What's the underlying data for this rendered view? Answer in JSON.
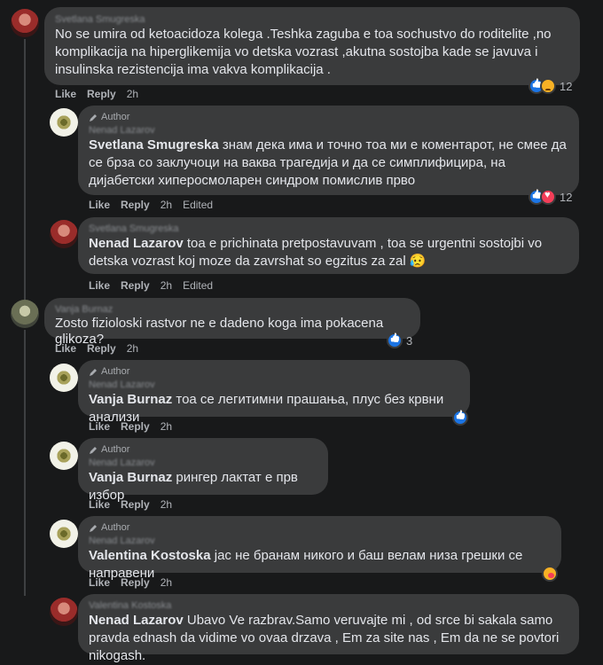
{
  "labels": {
    "like": "Like",
    "reply": "Reply",
    "author": "Author",
    "edited": "Edited"
  },
  "comments": [
    {
      "header_name": "Svetlana Smugreska",
      "text": "No se umira od ketoacidoza kolega .Teshka zaguba e toa sochustvo do roditelite ,no komplikacija na hiperglikemija vo detska vozrast ,akutna sostojba kade se javuva i insulinska rezistencija ima vakva komplikacija .",
      "time": "2h",
      "reaction_icons": [
        "like-icon",
        "sad-icon"
      ],
      "reaction_count": "12"
    },
    {
      "is_author": true,
      "header_name": "Nenad Lazarov",
      "mention": "Svetlana Smugreska",
      "text": " знам дека има и точно тоа ми е коментарот, не смее да се брза со заклучоци на ваква трагедија и да се симплифицира, на дијабетски хиперосмоларен синдром помислив прво",
      "time": "2h",
      "edited": true,
      "reaction_icons": [
        "like-icon",
        "love-icon"
      ],
      "reaction_count": "12"
    },
    {
      "header_name": "Svetlana Smugreska",
      "mention": "Nenad Lazarov",
      "text": " toa e prichinata pretpostavuvam , toa se urgentni sostojbi vo detska vozrast koj moze da zavrshat so egzitus za zal 😥",
      "time": "2h",
      "edited": true
    },
    {
      "header_name": "Vanja Burnaz",
      "text": "Zosto fizioloski rastvor ne e dadeno koga ima pokacena glikoza?",
      "time": "2h",
      "reaction_icons": [
        "like-icon"
      ],
      "reaction_count": "3"
    },
    {
      "is_author": true,
      "header_name": "Nenad Lazarov",
      "mention": "Vanja Burnaz",
      "text": " тоа се легитимни прашања, плус без крвни анализи",
      "time": "2h",
      "reaction_icons": [
        "like-icon"
      ]
    },
    {
      "is_author": true,
      "header_name": "Nenad Lazarov",
      "mention": "Vanja Burnaz",
      "text": " рингер лактат е прв избор",
      "time": "2h"
    },
    {
      "is_author": true,
      "header_name": "Nenad Lazarov",
      "mention": "Valentina Kostoska",
      "text": " јас не бранам никого и баш велам низа грешки се направени",
      "time": "2h",
      "reaction_icons": [
        "care-icon"
      ]
    },
    {
      "header_name": "Valentina Kostoska",
      "mention": "Nenad Lazarov",
      "text": " Ubavo Ve razbrav.Samo veruvajte mi , od srce bi sakala samo pravda ednash da vidime vo ovaa drzava , Em za site nas , Em da ne se povtori nikogash."
    }
  ]
}
